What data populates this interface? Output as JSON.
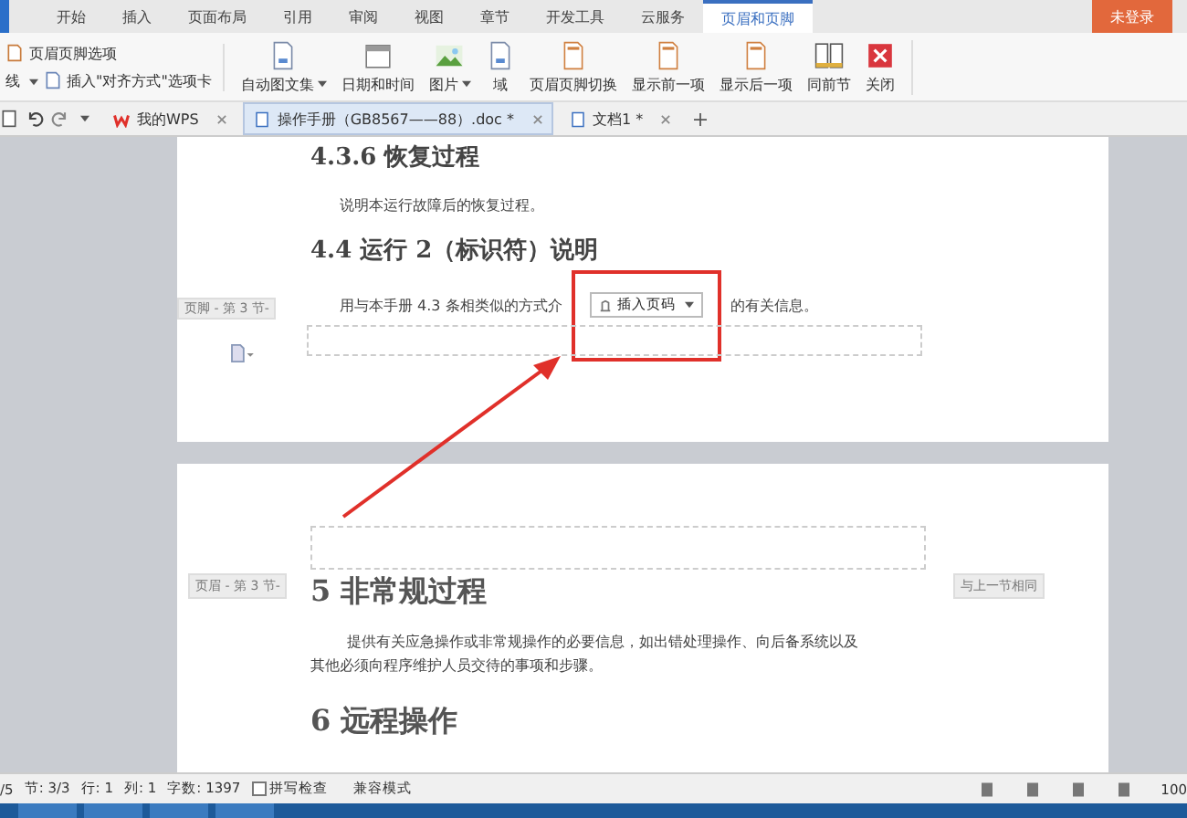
{
  "menu_tabs": [
    {
      "label": "开始",
      "selected": false
    },
    {
      "label": "插入",
      "selected": false
    },
    {
      "label": "页面布局",
      "selected": false
    },
    {
      "label": "引用",
      "selected": false
    },
    {
      "label": "审阅",
      "selected": false
    },
    {
      "label": "视图",
      "selected": false
    },
    {
      "label": "章节",
      "selected": false
    },
    {
      "label": "开发工具",
      "selected": false
    },
    {
      "label": "云服务",
      "selected": false
    },
    {
      "label": "页眉和页脚",
      "selected": true
    }
  ],
  "login_button": "未登录",
  "ribbon": {
    "options_label": "页眉页脚选项",
    "line_label": "线",
    "insert_tab_label": "插入\"对齐方式\"选项卡",
    "tools": [
      {
        "kind": "doc",
        "label": "自动图文集",
        "dropdown": true
      },
      {
        "kind": "calendar",
        "label": "日期和时间",
        "dropdown": false
      },
      {
        "kind": "picture",
        "label": "图片",
        "dropdown": true
      },
      {
        "kind": "doc",
        "label": "域",
        "dropdown": false
      },
      {
        "kind": "page",
        "label": "页眉页脚切换",
        "dropdown": false
      },
      {
        "kind": "page",
        "label": "显示前一项",
        "dropdown": false
      },
      {
        "kind": "page",
        "label": "显示后一项",
        "dropdown": false
      },
      {
        "kind": "pages",
        "label": "同前节",
        "dropdown": false
      },
      {
        "kind": "close",
        "label": "关闭",
        "dropdown": false
      }
    ]
  },
  "doc_tabs": [
    {
      "label": "我的WPS",
      "kind": "wps",
      "selected": false
    },
    {
      "label": "操作手册（GB8567——88）.doc *",
      "kind": "doc",
      "selected": true
    },
    {
      "label": "文档1 *",
      "kind": "doc",
      "selected": false
    }
  ],
  "page1": {
    "heading_1": "4.3.6 恢复过程",
    "paragraph_1": "说明本运行故障后的恢复过程。",
    "heading_2": "4.4 运行 2（标识符）说明",
    "paragraph_2_start": "用与本手册 4.3 条相类似的方式介",
    "paragraph_2_end": "的有关信息。",
    "popup_button": "插入页码",
    "footer_label": "页脚 - 第 3 节-"
  },
  "page2": {
    "header_label": "页眉 - 第 3 节-",
    "same_as_previous": "与上一节相同",
    "heading_1": "5 非常规过程",
    "paragraph": "提供有关应急操作或非常规操作的必要信息，如出错处理操作、向后备系统以及其他必须向程序维护人员交待的事项和步骤。",
    "heading_2": "6 远程操作"
  },
  "status_bar": {
    "items": [
      "/5",
      "节: 3/3",
      "行: 1",
      "列: 1",
      "字数: 1397"
    ],
    "spell_check": {
      "label": "拼写检查",
      "checked": false
    },
    "mode": "兼容模式",
    "zoom": "100"
  }
}
